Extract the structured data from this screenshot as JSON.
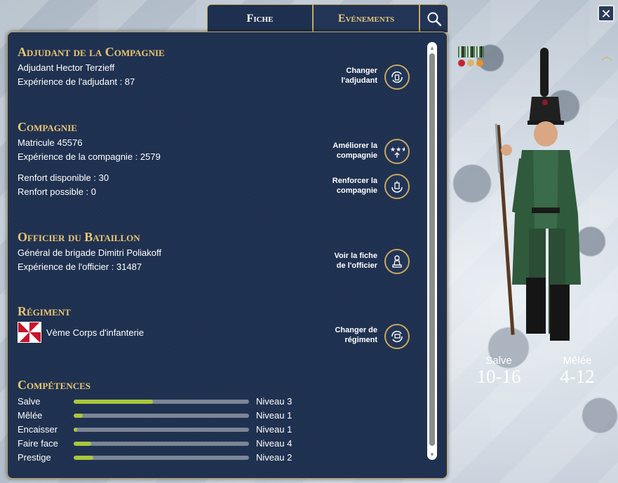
{
  "tabs": [
    {
      "label": "Fiche",
      "active": true
    },
    {
      "label": "Evénements",
      "active": false
    }
  ],
  "icons": {
    "search": "search-icon",
    "close": "close-icon"
  },
  "adjudant": {
    "title": "Adjudant de la Compagnie",
    "name": "Adjudant Hector Terzieff",
    "experience": "Expérience de l'adjudant : 87",
    "action_line1": "Changer",
    "action_line2": "l'adjudant"
  },
  "compagnie": {
    "title": "Compagnie",
    "matricule": "Matricule 45576",
    "experience": "Expérience de la compagnie : 2579",
    "renfort_disponible": "Renfort disponible : 30",
    "renfort_possible": "Renfort possible : 0",
    "improve_line1": "Améliorer la",
    "improve_line2": "compagnie",
    "reinforce_line1": "Renforcer la",
    "reinforce_line2": "compagnie"
  },
  "officier": {
    "title": "Officier du Bataillon",
    "name": "Général de brigade Dimitri Poliakoff",
    "experience": "Expérience de l'officier : 31487",
    "action_line1": "Voir la fiche",
    "action_line2": "de l'officier"
  },
  "regiment": {
    "title": "Régiment",
    "name": "Vème Corps d'infanterie",
    "action_line1": "Changer de",
    "action_line2": "régiment"
  },
  "competences": {
    "title": "Compétences",
    "skills": [
      {
        "name": "Salve",
        "level": "Niveau 3",
        "progress": 0.45
      },
      {
        "name": "Mêlée",
        "level": "Niveau 1",
        "progress": 0.05
      },
      {
        "name": "Encaisser",
        "level": "Niveau 1",
        "progress": 0.02
      },
      {
        "name": "Faire face",
        "level": "Niveau 4",
        "progress": 0.1
      },
      {
        "name": "Prestige",
        "level": "Niveau 2",
        "progress": 0.11
      }
    ]
  },
  "stats": {
    "salve_label": "Salve",
    "salve_value": "10-16",
    "melee_label": "Mêlée",
    "melee_value": "4-12"
  },
  "colors": {
    "panel": "#1e304f",
    "gold": "#c8a860",
    "title_gold": "#e9c674",
    "bar_fill": "#a9c73a",
    "bar_track": "#7b8696"
  }
}
